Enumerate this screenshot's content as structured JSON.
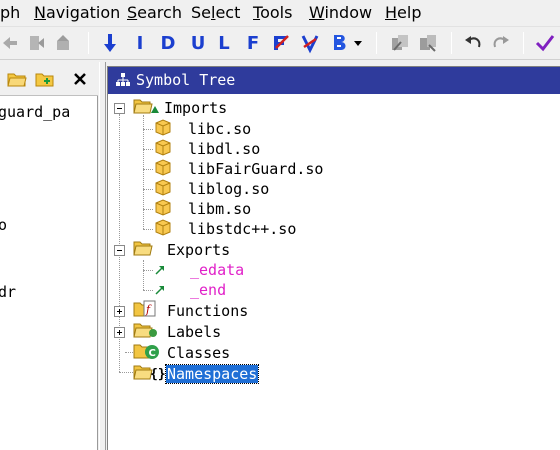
{
  "menu": [
    {
      "id": "graph",
      "label": "ph",
      "underline": "",
      "rest": "ph"
    },
    {
      "id": "navigation",
      "pre": "",
      "underline": "N",
      "rest": "avigation"
    },
    {
      "id": "search",
      "pre": "",
      "underline": "S",
      "rest": "earch"
    },
    {
      "id": "select",
      "pre": "Se",
      "underline": "l",
      "rest": "ect"
    },
    {
      "id": "tools",
      "pre": "",
      "underline": "T",
      "rest": "ools"
    },
    {
      "id": "window",
      "pre": "",
      "underline": "W",
      "rest": "indow"
    },
    {
      "id": "help",
      "pre": "",
      "underline": "H",
      "rest": "elp"
    }
  ],
  "toolbar": {
    "letters": [
      "I",
      "D",
      "U",
      "L",
      "F"
    ]
  },
  "left_panel": {
    "lines": [
      "guard_pa",
      "o",
      "dr"
    ]
  },
  "symbol_tree": {
    "title": "Symbol Tree",
    "imports": {
      "label": "Imports",
      "children": [
        "libc.so",
        "libdl.so",
        "libFairGuard.so",
        "liblog.so",
        "libm.so",
        "libstdc++.so"
      ]
    },
    "exports": {
      "label": "Exports",
      "children": [
        "_edata",
        "_end"
      ]
    },
    "functions": "Functions",
    "labels": "Labels",
    "classes": "Classes",
    "namespaces": "Namespaces"
  },
  "colors": {
    "title_bar": "#2f3b9c",
    "export_text": "#e020c8",
    "selection": "#1f6fd6",
    "toolbar_letters": "#1b3fcf"
  }
}
